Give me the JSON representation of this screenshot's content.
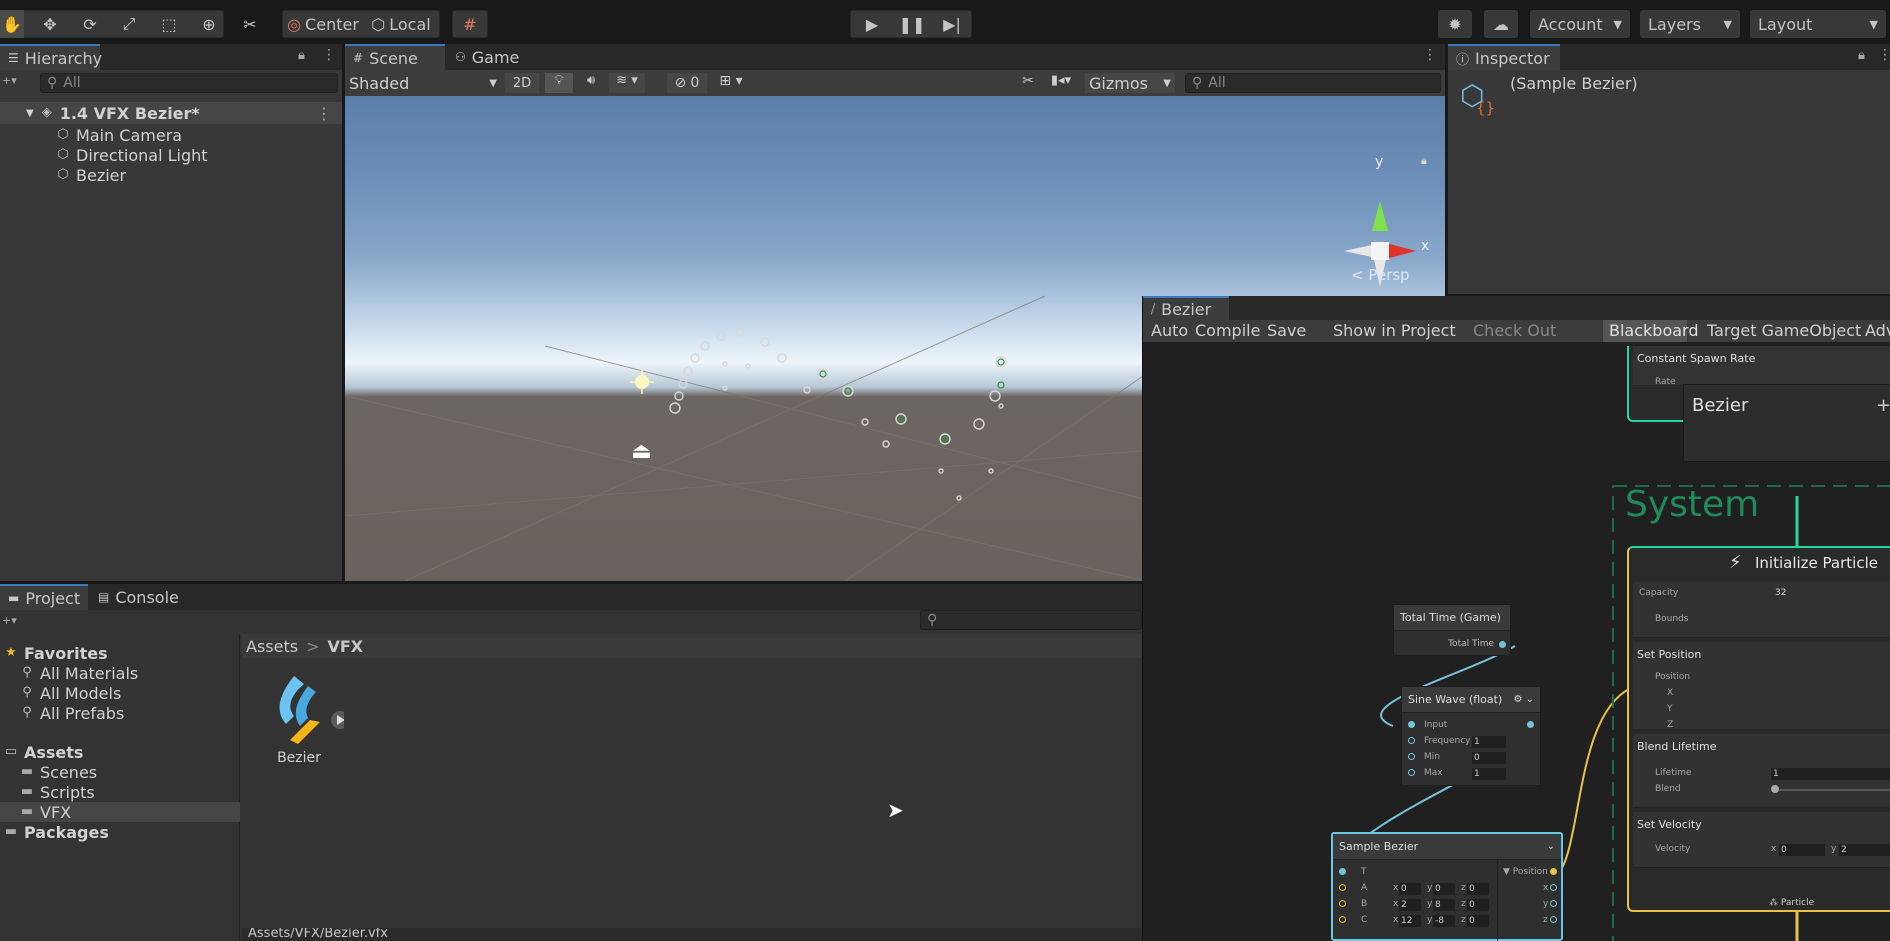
{
  "toolbar": {
    "pivot_label": "Center",
    "space_label": "Local",
    "account_label": "Account",
    "layers_label": "Layers",
    "layout_label": "Layout"
  },
  "hierarchy": {
    "tab_label": "Hierarchy",
    "search_placeholder": "All",
    "scene_name": "1.4 VFX Bezier*",
    "items": [
      "Main Camera",
      "Directional Light",
      "Bezier"
    ]
  },
  "scene_view": {
    "tabs": [
      "Scene",
      "Game"
    ],
    "shading_mode": "Shaded",
    "mode_2d": "2D",
    "hidden_count": "0",
    "gizmos_label": "Gizmos",
    "search_placeholder": "All",
    "persp_label": "< Persp",
    "axis_y": "y",
    "axis_x": "x"
  },
  "inspector": {
    "tab_label": "Inspector",
    "object_name": "(Sample Bezier)"
  },
  "project": {
    "tabs": [
      "Project",
      "Console"
    ],
    "favorites_label": "Favorites",
    "favorites": [
      "All Materials",
      "All Models",
      "All Prefabs"
    ],
    "assets_label": "Assets",
    "asset_folders": [
      "Scenes",
      "Scripts",
      "VFX"
    ],
    "packages_label": "Packages",
    "breadcrumb": [
      "Assets",
      "VFX"
    ],
    "asset_items": [
      "Bezier"
    ],
    "footer_path": "Assets/VFX/Bezier.vfx"
  },
  "vfx_graph": {
    "window_title": "Bezier",
    "toolbar": [
      "Auto",
      "Compile",
      "Save",
      "Show in Project",
      "Check Out",
      "Blackboard",
      "Target GameObject",
      "Adv"
    ],
    "blackboard_title": "Bezier",
    "blackboard_add": "+",
    "system_label": "System",
    "spawn": {
      "title": "Constant Spawn Rate",
      "rate_label": "Rate"
    },
    "initialize": {
      "title": "Initialize Particle",
      "capacity_label": "Capacity",
      "capacity_value": "32",
      "bounds_label": "Bounds",
      "set_position": "Set Position",
      "position_label": "Position",
      "x": "X",
      "y": "Y",
      "z": "Z",
      "blend_lifetime": "Blend Lifetime",
      "lifetime_label": "Lifetime",
      "lifetime_value": "1",
      "blend_label": "Blend",
      "set_velocity": "Set Velocity",
      "velocity_label": "Velocity",
      "vel_x_label": "x",
      "vel_x": "0",
      "vel_y_label": "y",
      "vel_y": "2",
      "particle_label": "Particle"
    },
    "total_time": {
      "title": "Total Time (Game)",
      "output": "Total Time"
    },
    "sine": {
      "title": "Sine Wave (float)",
      "input": "Input",
      "frequency_label": "Frequency",
      "frequency": "1",
      "min_label": "Min",
      "min": "0",
      "max_label": "Max",
      "max": "1"
    },
    "bezier": {
      "title": "Sample Bezier",
      "t_label": "T",
      "output": "Position",
      "rows": [
        {
          "label": "A",
          "x": "0",
          "y": "0",
          "z": "0"
        },
        {
          "label": "B",
          "x": "2",
          "y": "8",
          "z": "0"
        },
        {
          "label": "C",
          "x": "12",
          "y": "-8",
          "z": "0"
        }
      ],
      "out_x": "x",
      "out_y": "y",
      "out_z": "z",
      "lbl_x": "x",
      "lbl_y": "y",
      "lbl_z": "z"
    }
  },
  "colors": {
    "accent": "#3a79bb",
    "flow": "#1fd9a0",
    "port_float": "#76c2d9",
    "port_vector": "#e8c24a"
  }
}
